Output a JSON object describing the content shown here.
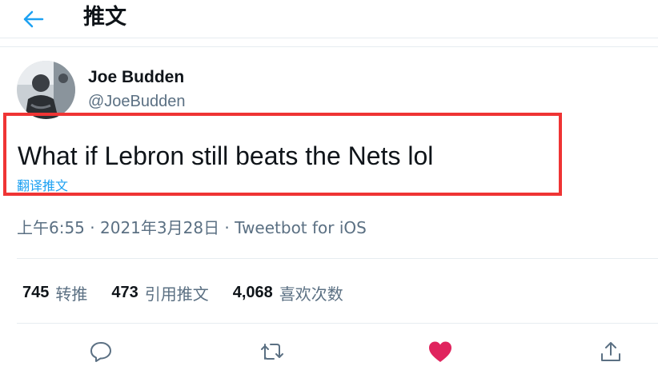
{
  "header": {
    "back_icon": "arrow-left-icon",
    "title": "推文"
  },
  "author": {
    "display_name": "Joe Budden",
    "handle": "@JoeBudden",
    "avatar_icon": "avatar-photo"
  },
  "tweet": {
    "text": "What if Lebron still beats the Nets lol",
    "translate_label": "翻译推文"
  },
  "meta": {
    "time": "上午6:55",
    "separator": " · ",
    "date": "2021年3月28日",
    "source": "Tweetbot for iOS"
  },
  "stats": {
    "retweets": {
      "count": "745",
      "label": "转推"
    },
    "quotes": {
      "count": "473",
      "label": "引用推文"
    },
    "likes": {
      "count": "4,068",
      "label": "喜欢次数"
    }
  },
  "actions": {
    "reply_icon": "reply-icon",
    "retweet_icon": "retweet-icon",
    "like_icon": "heart-icon",
    "share_icon": "share-icon"
  },
  "colors": {
    "accent": "#1da1f2",
    "like": "#e0245e",
    "highlight": "#ef3434",
    "secondary_text": "#5b7083"
  }
}
